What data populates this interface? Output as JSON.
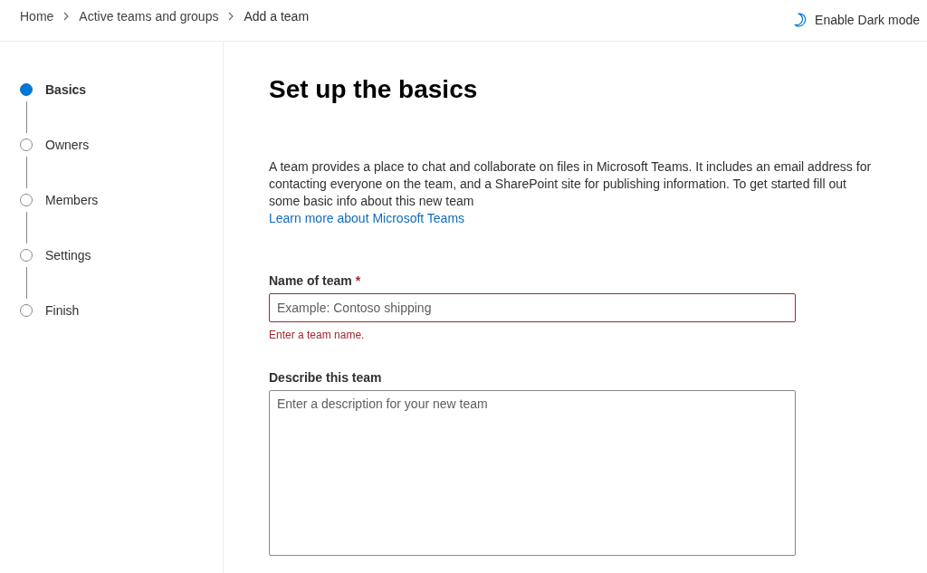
{
  "breadcrumb": [
    {
      "label": "Home"
    },
    {
      "label": "Active teams and groups"
    },
    {
      "label": "Add a team"
    }
  ],
  "header_action": {
    "label": "Enable Dark mode"
  },
  "steps": [
    {
      "label": "Basics",
      "selected": true
    },
    {
      "label": "Owners",
      "selected": false
    },
    {
      "label": "Members",
      "selected": false
    },
    {
      "label": "Settings",
      "selected": false
    },
    {
      "label": "Finish",
      "selected": false
    }
  ],
  "page": {
    "title": "Set up the basics",
    "description": "A team provides a place to chat and collaborate on files in Microsoft Teams. It includes an email address for contacting everyone on the team, and a SharePoint site for publishing information. To get started fill out some basic info about this new team",
    "link": "Learn more about Microsoft Teams"
  },
  "fields": [
    {
      "kind": "input",
      "label": "Name of team",
      "required_mark": "*",
      "placeholder": "Example: Contoso shipping",
      "error": "Enter a team name."
    },
    {
      "kind": "textarea",
      "label": "Describe this team",
      "placeholder": "Enter a description for your new team"
    }
  ]
}
